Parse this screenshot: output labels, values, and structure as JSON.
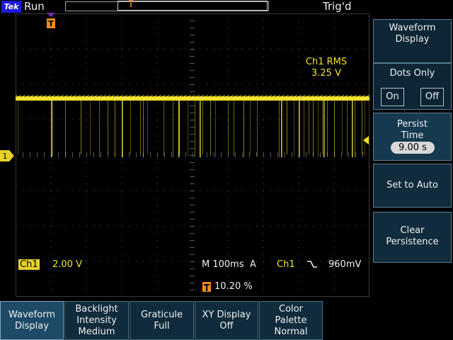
{
  "status": {
    "brand": "Tek",
    "acq_state": "Run",
    "trigger_state": "Trig'd"
  },
  "markers": {
    "trigger_position_glyph": "T",
    "channel_ground_glyph": "1"
  },
  "measurement": {
    "label": "Ch1 RMS",
    "value": "3.25 V"
  },
  "readouts": {
    "channel": "Ch1",
    "vertical_scale": "2.00 V",
    "timebase": "M 100ms  A",
    "trigger_source": "Ch1",
    "trigger_slope_icon": "falling-edge-icon",
    "trigger_level": "960mV",
    "trigger_position": "10.20 %"
  },
  "side_menu": {
    "title_line1": "Waveform",
    "title_line2": "Display",
    "dots_only_label": "Dots Only",
    "on_label": "On",
    "off_label": "Off",
    "persist_line1": "Persist",
    "persist_line2": "Time",
    "persist_value": "9.00 s",
    "set_auto_label": "Set to Auto",
    "clear_line1": "Clear",
    "clear_line2": "Persistence"
  },
  "bottom_menu": [
    {
      "line1": "Waveform",
      "line2": "Display",
      "line3": ""
    },
    {
      "line1": "Backlight",
      "line2": "Intensity",
      "line3": "Medium"
    },
    {
      "line1": "Graticule",
      "line2": "Full",
      "line3": ""
    },
    {
      "line1": "XY Display",
      "line2": "Off",
      "line3": ""
    },
    {
      "line1": "Color",
      "line2": "Palette",
      "line3": "Normal"
    }
  ],
  "colors": {
    "trace": "#f2e12e",
    "marker_orange": "#f08a1e",
    "graticule": "#5a5a5a"
  }
}
